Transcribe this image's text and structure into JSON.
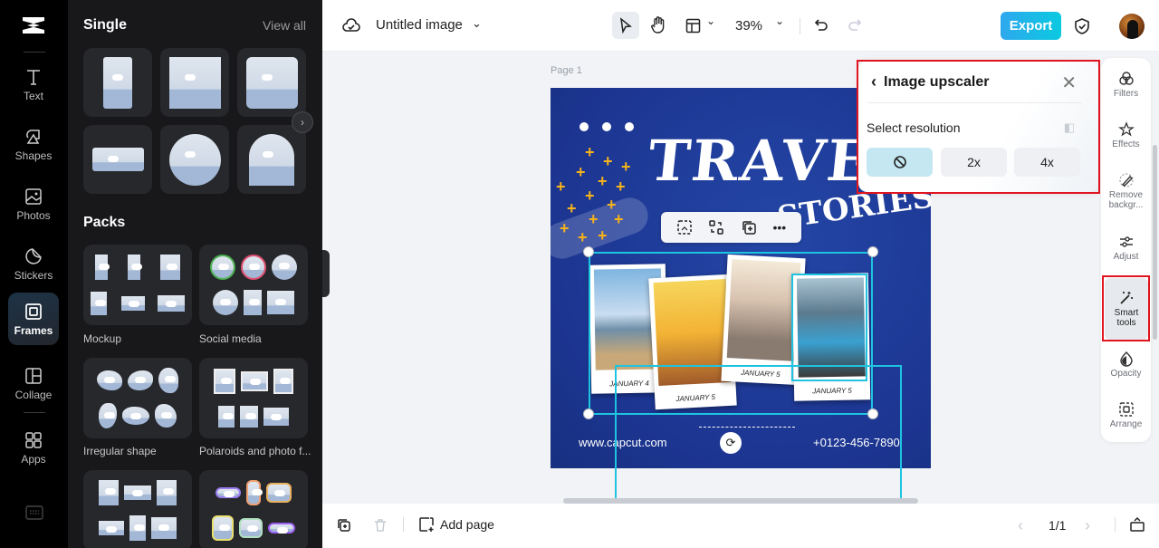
{
  "app": {
    "document_title": "Untitled image"
  },
  "rail": {
    "items": [
      {
        "label": "Text",
        "icon": "text-icon"
      },
      {
        "label": "Shapes",
        "icon": "shapes-icon"
      },
      {
        "label": "Photos",
        "icon": "photos-icon"
      },
      {
        "label": "Stickers",
        "icon": "stickers-icon"
      },
      {
        "label": "Frames",
        "icon": "frames-icon",
        "active": true
      },
      {
        "label": "Collage",
        "icon": "collage-icon"
      },
      {
        "label": "Apps",
        "icon": "apps-icon"
      }
    ]
  },
  "panel": {
    "single_heading": "Single",
    "view_all": "View all",
    "packs_heading": "Packs",
    "packs": [
      {
        "label": "Mockup"
      },
      {
        "label": "Social media"
      },
      {
        "label": "Irregular shape"
      },
      {
        "label": "Polaroids and photo f..."
      }
    ]
  },
  "toolbar": {
    "zoom": "39%",
    "export_label": "Export"
  },
  "canvas": {
    "page_label": "Page 1",
    "poster": {
      "title": "TRAVEL",
      "subtitle": "STORIES",
      "captions": [
        "JANUARY 4",
        "JANUARY 5",
        "JANUARY 5",
        "JANUARY 5"
      ],
      "website": "www.capcut.com",
      "phone": "+0123-456-7890"
    },
    "float_toolbar": [
      "crop-image-icon",
      "replace-icon",
      "duplicate-icon",
      "more-icon"
    ]
  },
  "upscaler": {
    "title": "Image upscaler",
    "select_label": "Select resolution",
    "options": [
      {
        "label": "",
        "icon": "none-icon",
        "selected": true
      },
      {
        "label": "2x"
      },
      {
        "label": "4x"
      }
    ]
  },
  "right_tools": [
    {
      "label": "Filters"
    },
    {
      "label": "Effects"
    },
    {
      "label": "Remove backgr..."
    },
    {
      "label": "Adjust"
    },
    {
      "label": "Smart tools",
      "active": true
    },
    {
      "label": "Opacity"
    },
    {
      "label": "Arrange"
    }
  ],
  "bottom": {
    "add_page": "Add page",
    "page_indicator": "1/1"
  },
  "colors": {
    "accent": "#1ec3e0",
    "export_start": "#2ea8ee",
    "export_end": "#0bc9e0",
    "highlight": "#e0151f",
    "poster_bg": "#1c3591"
  }
}
